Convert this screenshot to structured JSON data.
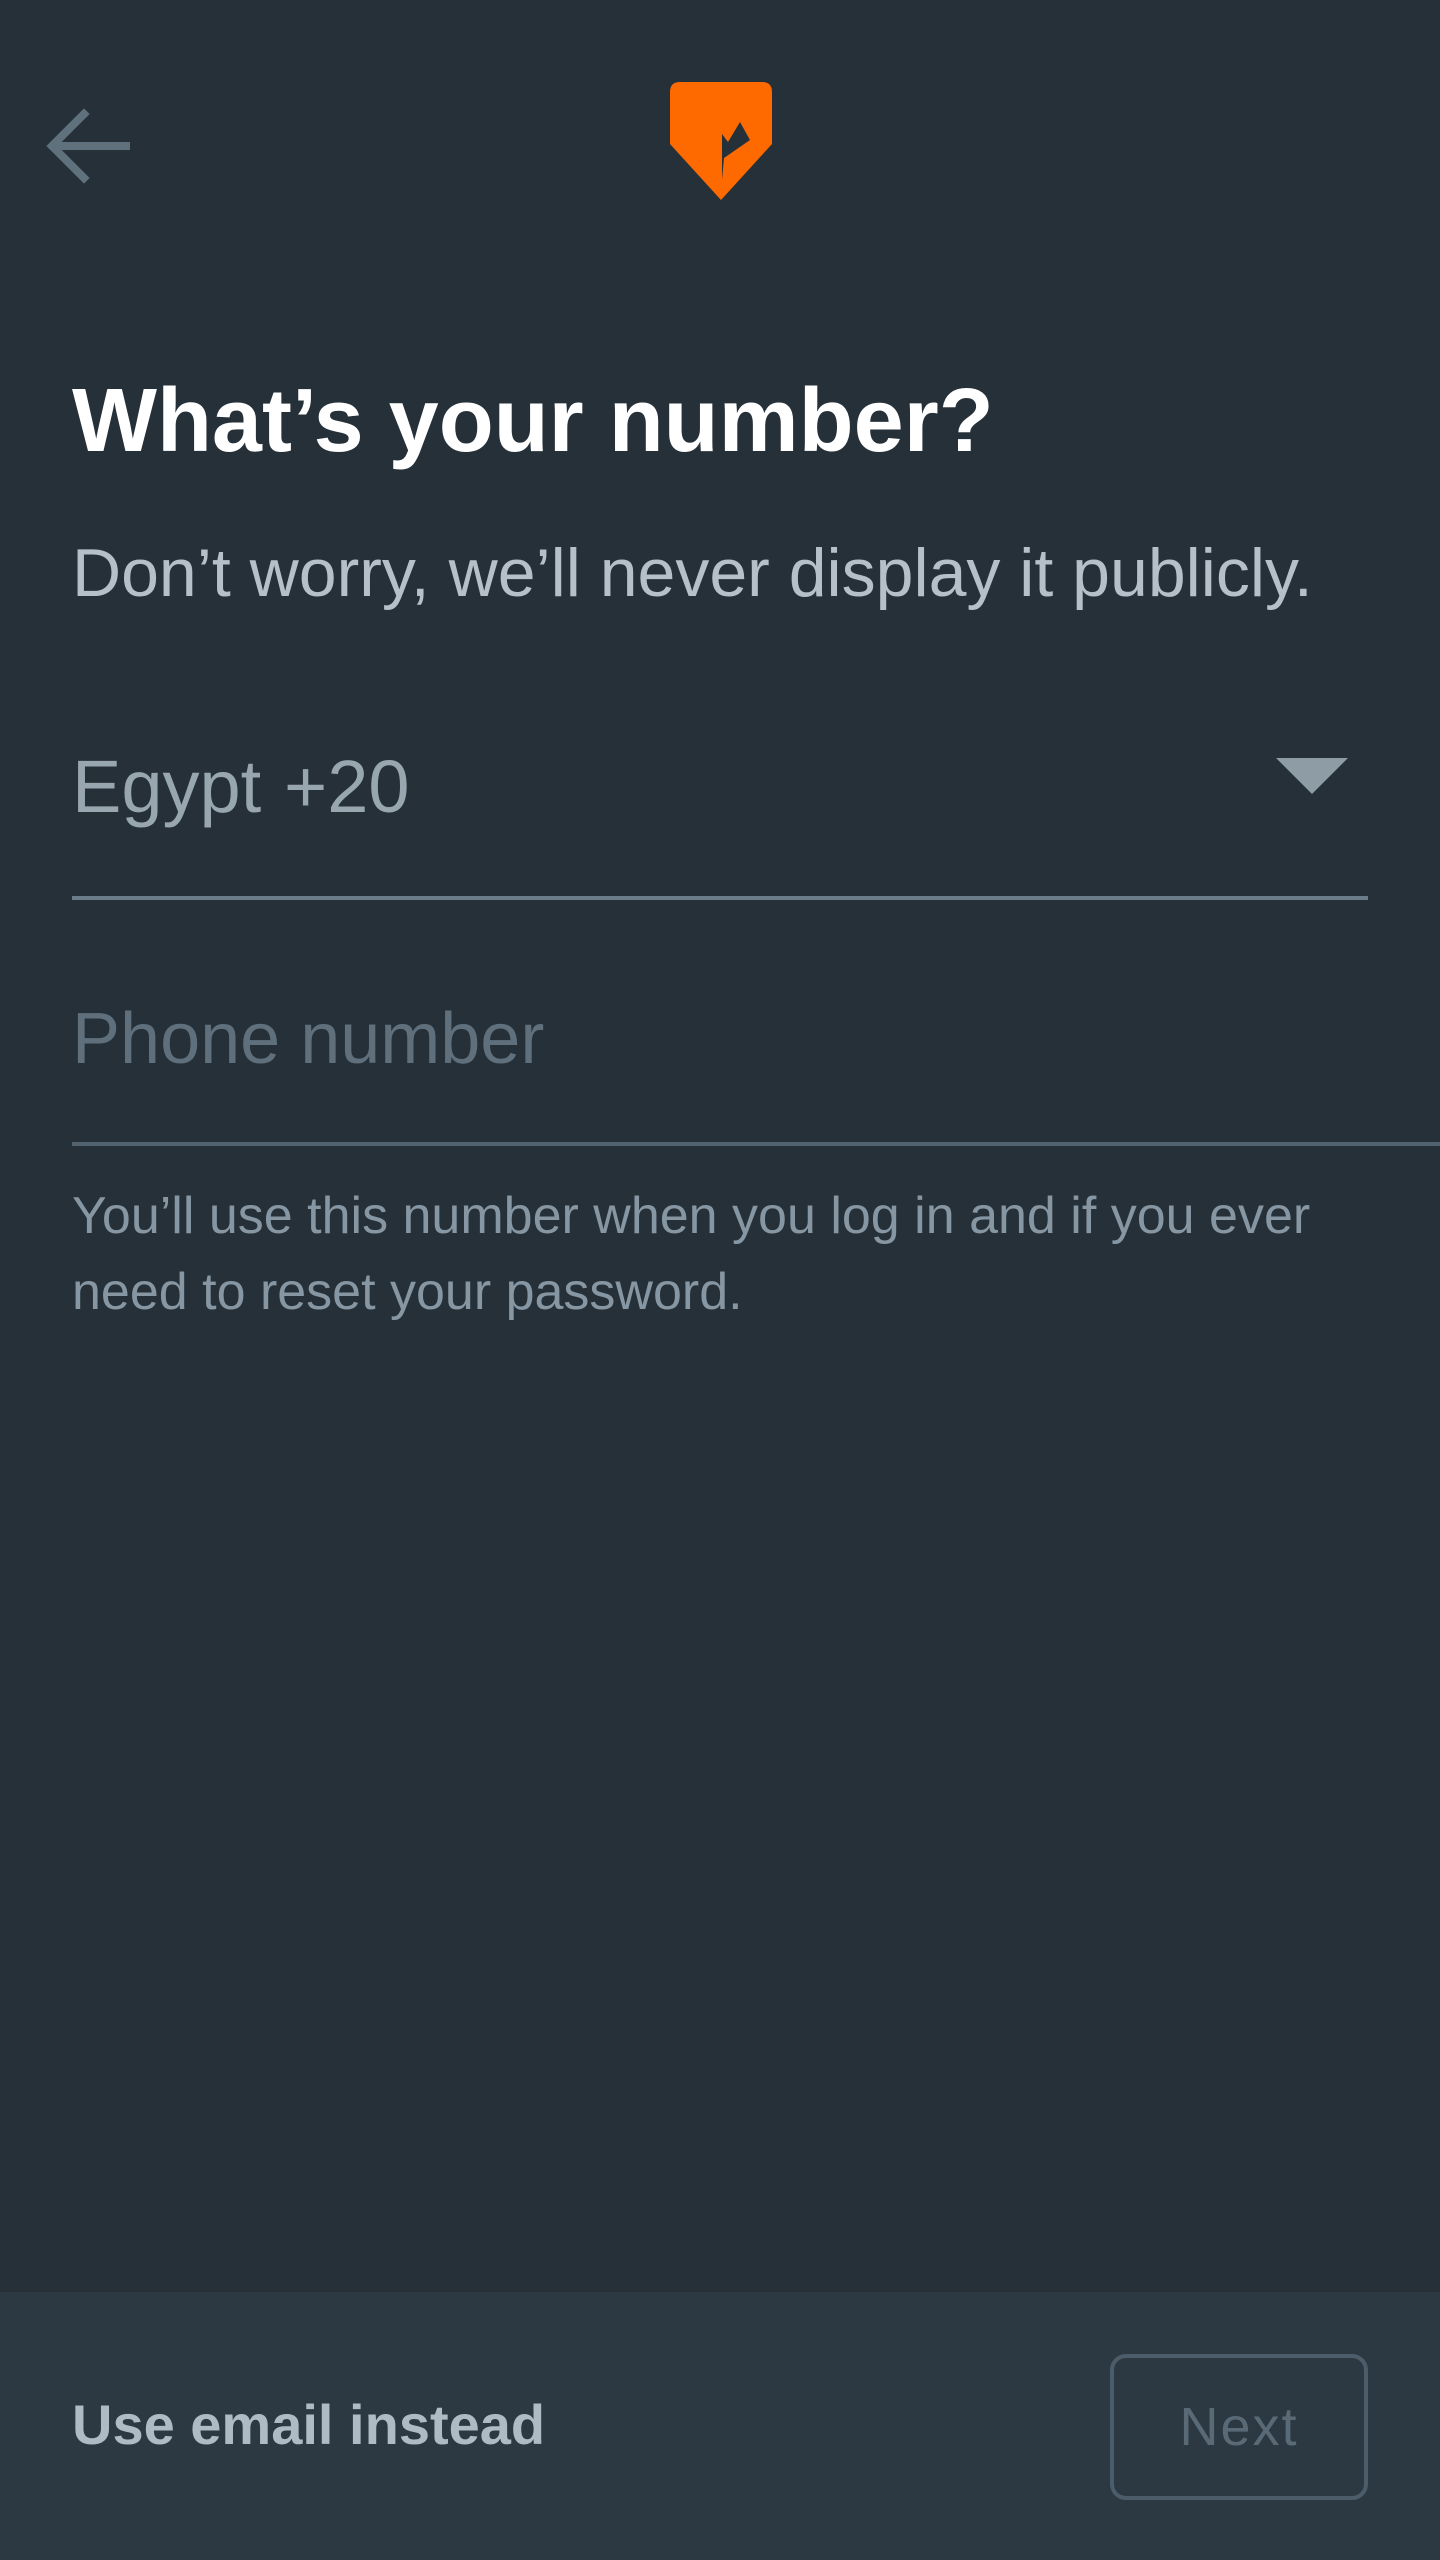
{
  "header": {
    "back_icon": "arrow-left-icon",
    "logo_icon": "app-logo-icon",
    "accent_color": "#ff6a00"
  },
  "content": {
    "title": "What’s your number?",
    "subtitle": "Don’t worry, we’ll never display it publicly.",
    "country": {
      "name": "Egypt",
      "dial_code": "+20",
      "caret_icon": "caret-down-icon"
    },
    "phone": {
      "placeholder": "Phone number",
      "value": ""
    },
    "helper": "You’ll use this number when you log in and if you ever need to reset your password."
  },
  "footer": {
    "email_link": "Use email instead",
    "next_label": "Next"
  }
}
